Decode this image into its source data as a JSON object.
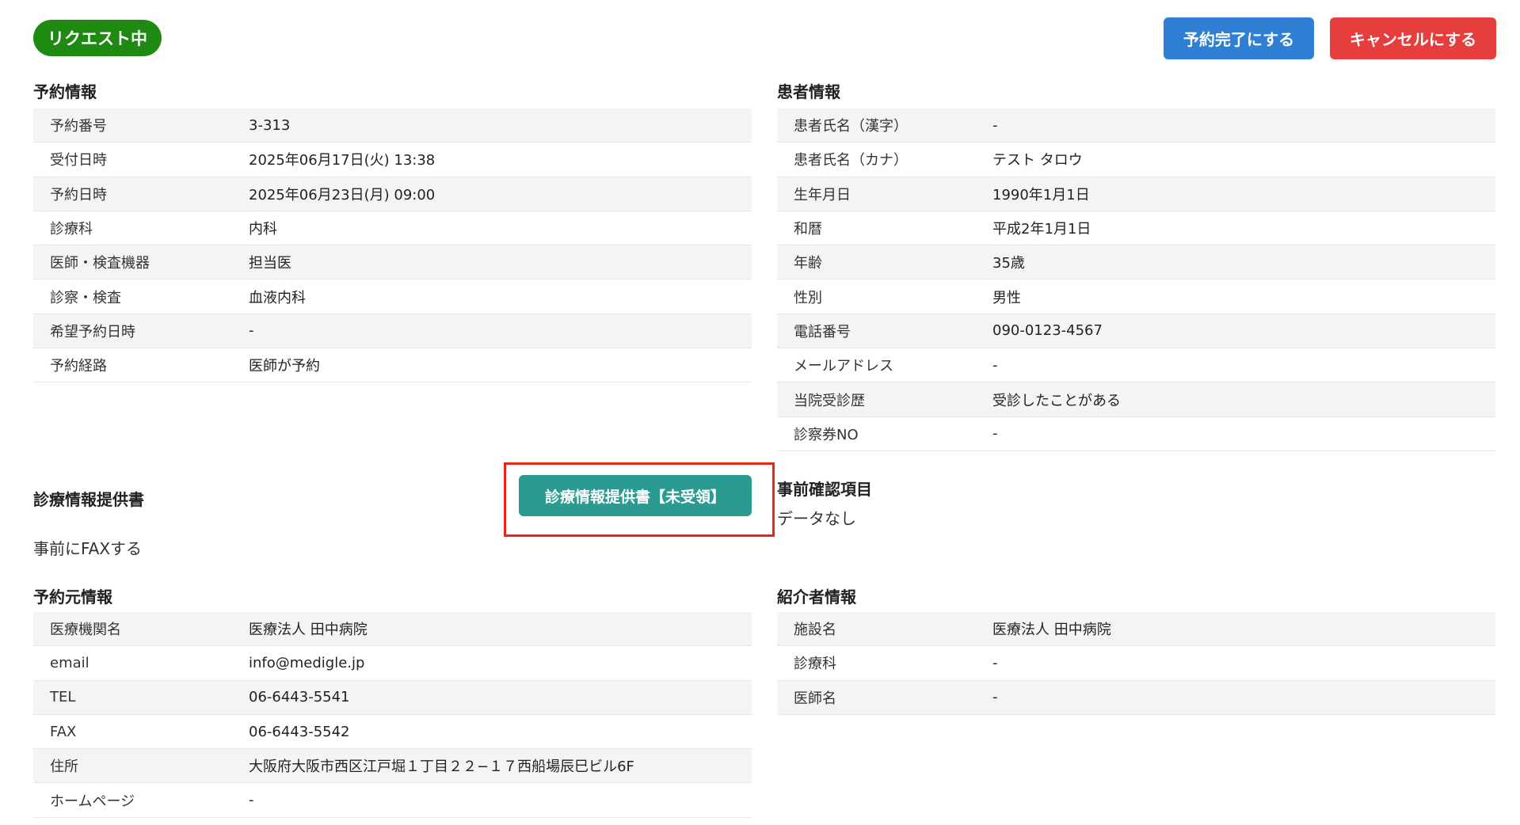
{
  "status": "リクエスト中",
  "buttons": {
    "complete": "予約完了にする",
    "cancel": "キャンセルにする",
    "document": "診療情報提供書【未受領】"
  },
  "reservation": {
    "title": "予約情報",
    "rows": [
      {
        "label": "予約番号",
        "value": "3-313"
      },
      {
        "label": "受付日時",
        "value": "2025年06月17日(火) 13:38"
      },
      {
        "label": "予約日時",
        "value": "2025年06月23日(月) 09:00"
      },
      {
        "label": "診療科",
        "value": "内科"
      },
      {
        "label": "医師・検査機器",
        "value": "担当医"
      },
      {
        "label": "診察・検査",
        "value": "血液内科"
      },
      {
        "label": "希望予約日時",
        "value": "-"
      },
      {
        "label": "予約経路",
        "value": "医師が予約"
      }
    ]
  },
  "patient": {
    "title": "患者情報",
    "rows": [
      {
        "label": "患者氏名（漢字）",
        "value": "-"
      },
      {
        "label": "患者氏名（カナ）",
        "value": "テスト タロウ"
      },
      {
        "label": "生年月日",
        "value": "1990年1月1日"
      },
      {
        "label": "和暦",
        "value": "平成2年1月1日"
      },
      {
        "label": "年齢",
        "value": "35歳"
      },
      {
        "label": "性別",
        "value": "男性"
      },
      {
        "label": "電話番号",
        "value": "090-0123-4567"
      },
      {
        "label": "メールアドレス",
        "value": "-"
      },
      {
        "label": "当院受診歴",
        "value": "受診したことがある"
      },
      {
        "label": "診察券NO",
        "value": "-"
      }
    ]
  },
  "document": {
    "title": "診療情報提供書",
    "text": "事前にFAXする"
  },
  "precheck": {
    "title": "事前確認項目",
    "text": "データなし"
  },
  "source": {
    "title": "予約元情報",
    "rows": [
      {
        "label": "医療機関名",
        "value": "医療法人 田中病院"
      },
      {
        "label": "email",
        "value": "info@medigle.jp"
      },
      {
        "label": "TEL",
        "value": "06-6443-5541"
      },
      {
        "label": "FAX",
        "value": "06-6443-5542"
      },
      {
        "label": "住所",
        "value": "大阪府大阪市西区江戸堀１丁目２２−１７西船場辰巳ビル6F"
      },
      {
        "label": "ホームページ",
        "value": "-"
      }
    ]
  },
  "referrer": {
    "title": "紹介者情報",
    "rows": [
      {
        "label": "施設名",
        "value": "医療法人 田中病院"
      },
      {
        "label": "診療科",
        "value": "-"
      },
      {
        "label": "医師名",
        "value": "-"
      }
    ]
  },
  "colors": {
    "status_badge": "#1e8a12",
    "complete_button": "#2f7fd4",
    "cancel_button": "#e63d3d",
    "document_button": "#2b9b91",
    "highlight": "#e8261c"
  }
}
